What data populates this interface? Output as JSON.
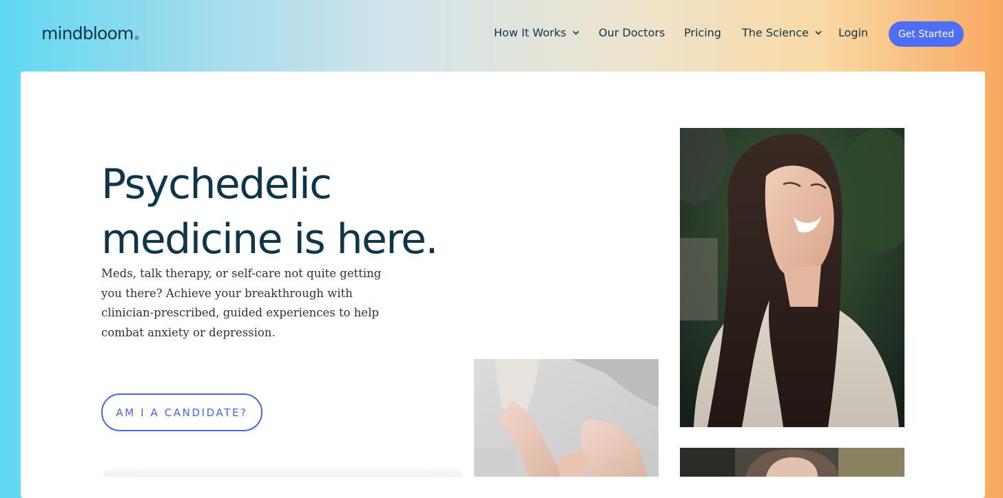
{
  "brand": {
    "logo_text": "mindbloom",
    "logo_mark": "®"
  },
  "nav": {
    "items": [
      {
        "label": "How It Works",
        "has_dropdown": true
      },
      {
        "label": "Our Doctors",
        "has_dropdown": false
      },
      {
        "label": "Pricing",
        "has_dropdown": false
      },
      {
        "label": "The Science",
        "has_dropdown": true
      },
      {
        "label": "Login",
        "has_dropdown": false
      }
    ],
    "cta_label": "Get Started"
  },
  "hero": {
    "headline_line1": "Psychedelic",
    "headline_line2": "medicine is here.",
    "subtext": "Meds, talk therapy, or self-care not quite getting you there? Achieve your breakthrough with clinician-prescribed, guided experiences to help combat anxiety or depression.",
    "cta_label": "AM I A CANDIDATE?"
  },
  "colors": {
    "accent": "#4f6ef7",
    "text_dark": "#0f3548",
    "outline_button": "#4a63e8"
  },
  "images": [
    {
      "name": "smiling-woman-photo"
    },
    {
      "name": "hands-closeup-photo"
    },
    {
      "name": "woman-partial-photo"
    }
  ]
}
